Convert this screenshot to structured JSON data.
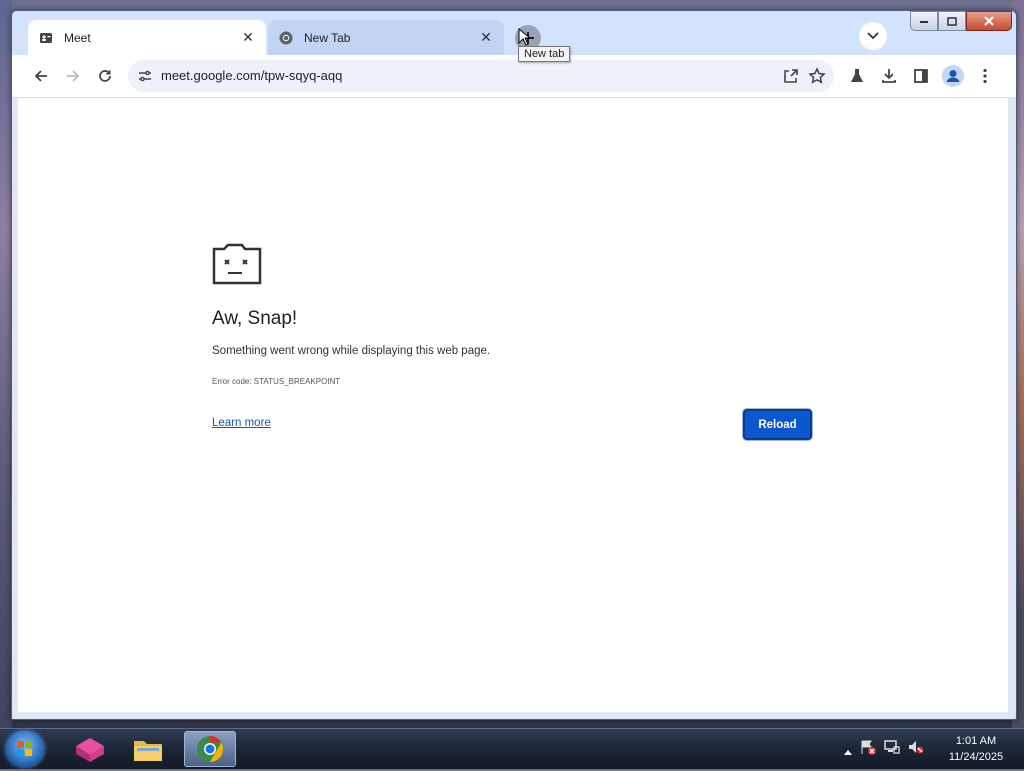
{
  "browser": {
    "tabs": [
      {
        "title": "Meet",
        "active": true
      },
      {
        "title": "New Tab",
        "active": false
      }
    ],
    "new_tab_tooltip": "New tab",
    "url": "meet.google.com/tpw-sqyq-aqq"
  },
  "error_page": {
    "title": "Aw, Snap!",
    "message": "Something went wrong while displaying this web page.",
    "error_code": "Error code: STATUS_BREAKPOINT",
    "learn_more": "Learn more",
    "reload": "Reload"
  },
  "taskbar": {
    "time": "1:01 AM",
    "date": "11/24/2025"
  },
  "colors": {
    "accent": "#0b57d0",
    "tabstrip": "#d3e3fd",
    "omnibox": "#edf2fa",
    "link": "#1a56b0"
  }
}
